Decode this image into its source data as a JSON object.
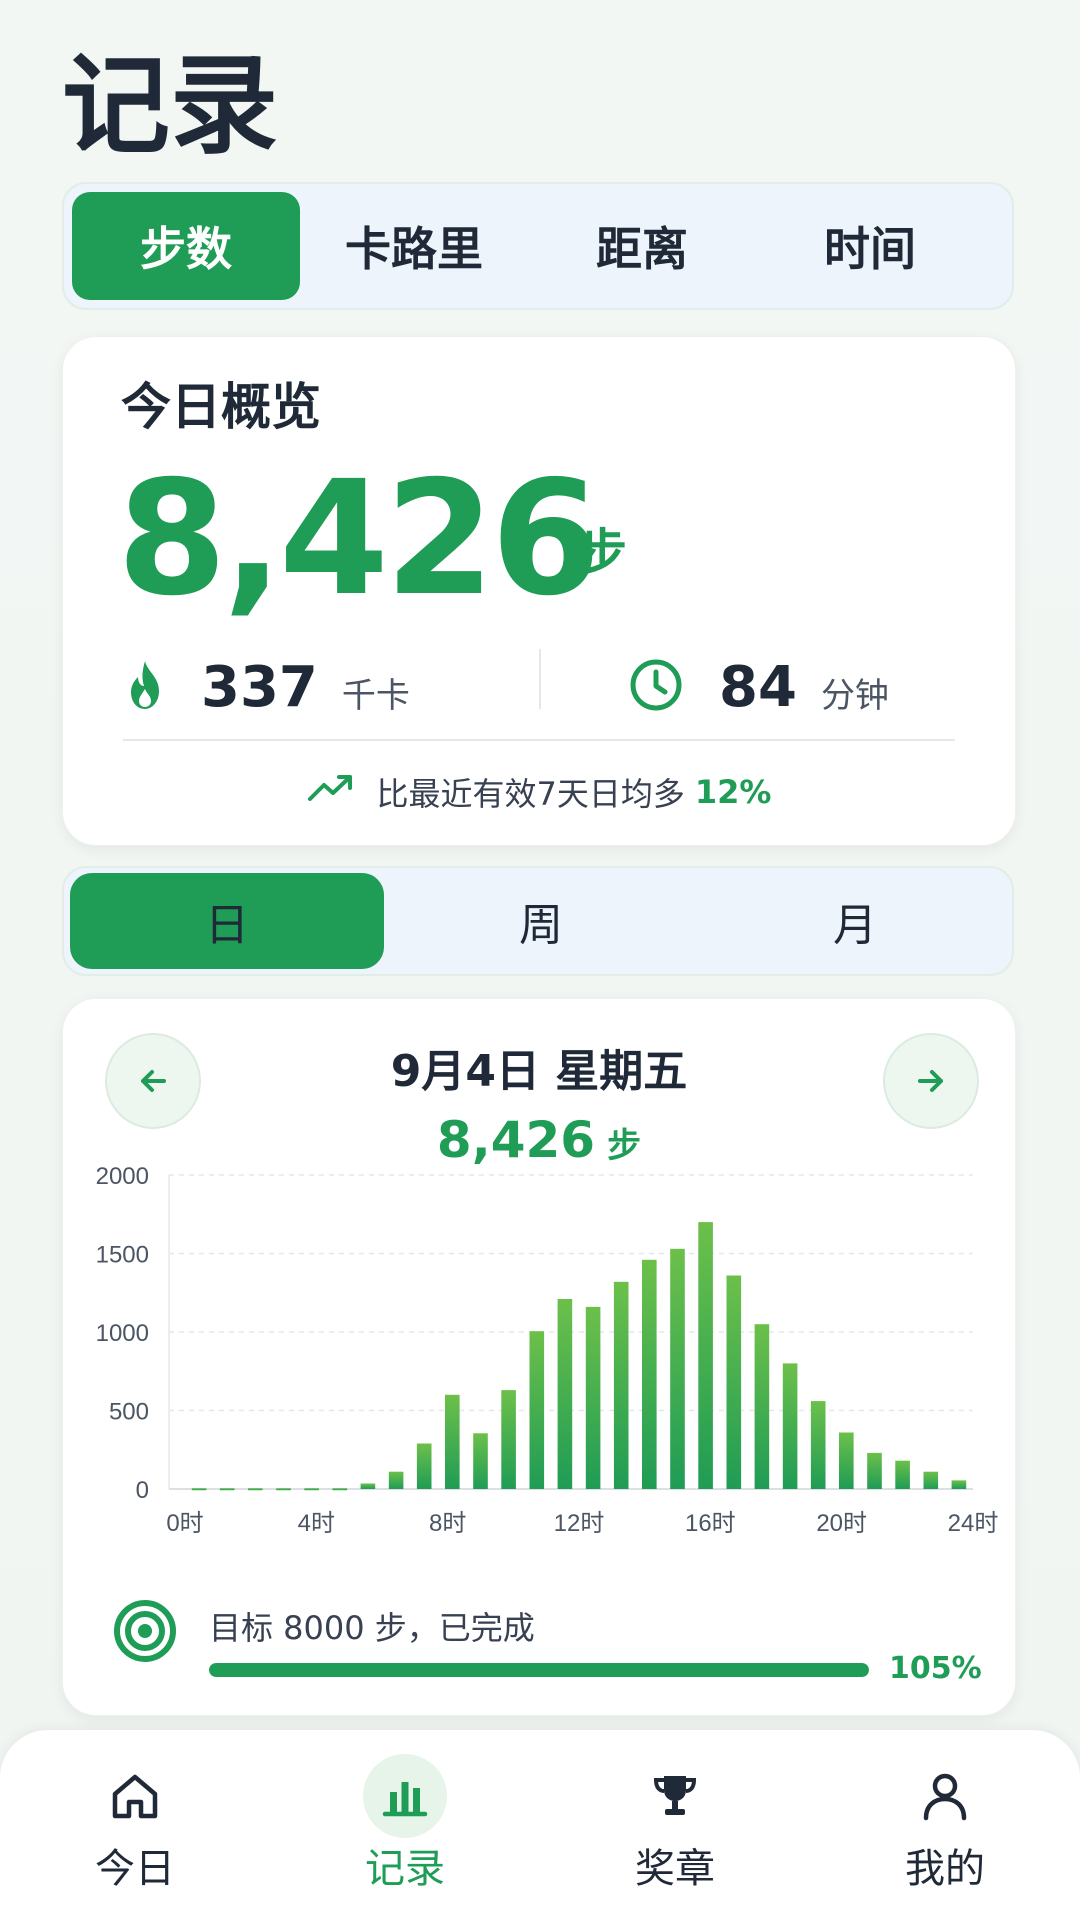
{
  "page_title": "记录",
  "metric_tabs": [
    "步数",
    "卡路里",
    "距离",
    "时间"
  ],
  "overview": {
    "title": "今日概览",
    "value": "8,426",
    "unit": "步",
    "calories": {
      "value": "337",
      "unit": "千卡",
      "icon": "flame-icon"
    },
    "minutes": {
      "value": "84",
      "unit": "分钟",
      "icon": "clock-icon"
    },
    "compare_text": "比最近有效7天日均多",
    "compare_pct": "12%"
  },
  "period_tabs": [
    "日",
    "周",
    "月"
  ],
  "day_card": {
    "date": "9月4日 星期五",
    "steps": "8,426",
    "steps_unit": "步"
  },
  "chart_data": {
    "type": "bar",
    "categories": [
      "0",
      "1",
      "2",
      "3",
      "4",
      "5",
      "6",
      "7",
      "8",
      "9",
      "10",
      "11",
      "12",
      "13",
      "14",
      "15",
      "16",
      "17",
      "18",
      "19",
      "20",
      "21",
      "22",
      "23"
    ],
    "values": [
      5,
      5,
      5,
      5,
      5,
      5,
      35,
      110,
      290,
      600,
      355,
      630,
      1005,
      1210,
      1160,
      1320,
      1460,
      1530,
      1700,
      1360,
      1050,
      800,
      560,
      360
    ],
    "extra_tail": [
      230,
      180,
      110,
      55
    ],
    "ylim": [
      0,
      2000
    ],
    "yticks": [
      0,
      500,
      1000,
      1500,
      2000
    ],
    "xtick_labels": [
      "0时",
      "4时",
      "8时",
      "12时",
      "16时",
      "20时",
      "24时"
    ],
    "grid": true,
    "colors": {
      "bar_top": "#6cc04a",
      "bar_bottom": "#1f9c55"
    }
  },
  "goal": {
    "text": "目标 8000 步，已完成",
    "progress": 1.05,
    "pct_label": "105%"
  },
  "bottom_nav": [
    {
      "label": "今日",
      "icon": "home-icon",
      "active": false
    },
    {
      "label": "记录",
      "icon": "bar-chart-icon",
      "active": true
    },
    {
      "label": "奖章",
      "icon": "trophy-icon",
      "active": false
    },
    {
      "label": "我的",
      "icon": "user-icon",
      "active": false
    }
  ],
  "colors": {
    "accent": "#1f9c55",
    "text": "#1f2937"
  }
}
